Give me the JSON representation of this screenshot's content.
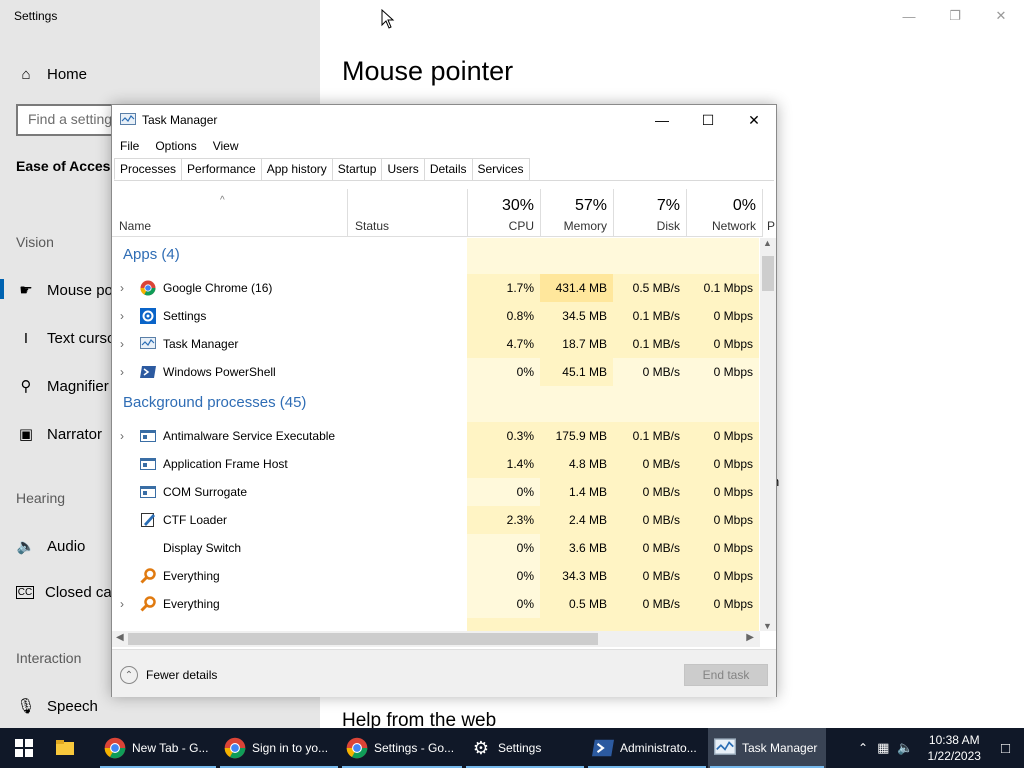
{
  "settings": {
    "window_title": "Settings",
    "nav_home": "Home",
    "search_placeholder": "Find a setting",
    "category": "Ease of Access",
    "section_vision": "Vision",
    "item_mouse": "Mouse pointer",
    "item_text_cursor": "Text cursor",
    "item_magnifier": "Magnifier",
    "item_narrator": "Narrator",
    "section_hearing": "Hearing",
    "item_audio": "Audio",
    "item_captions": "Closed captions",
    "section_interaction": "Interaction",
    "item_speech": "Speech",
    "page_title": "Mouse pointer",
    "help_title": "Help from the web",
    "stray_text": "n"
  },
  "taskmanager": {
    "title": "Task Manager",
    "menu": [
      "File",
      "Options",
      "View"
    ],
    "tabs": [
      "Processes",
      "Performance",
      "App history",
      "Startup",
      "Users",
      "Details",
      "Services"
    ],
    "columns": {
      "name": "Name",
      "status": "Status",
      "cpu_pct": "30%",
      "cpu": "CPU",
      "mem_pct": "57%",
      "mem": "Memory",
      "disk_pct": "7%",
      "disk": "Disk",
      "net_pct": "0%",
      "net": "Network",
      "power": "P"
    },
    "groups": {
      "apps": "Apps (4)",
      "background": "Background processes (45)"
    },
    "apps": [
      {
        "name": "Google Chrome (16)",
        "cpu": "1.7%",
        "mem": "431.4 MB",
        "disk": "0.5 MB/s",
        "net": "0.1 Mbps"
      },
      {
        "name": "Settings",
        "cpu": "0.8%",
        "mem": "34.5 MB",
        "disk": "0.1 MB/s",
        "net": "0 Mbps"
      },
      {
        "name": "Task Manager",
        "cpu": "4.7%",
        "mem": "18.7 MB",
        "disk": "0.1 MB/s",
        "net": "0 Mbps"
      },
      {
        "name": "Windows PowerShell",
        "cpu": "0%",
        "mem": "45.1 MB",
        "disk": "0 MB/s",
        "net": "0 Mbps"
      }
    ],
    "background": [
      {
        "name": "Antimalware Service Executable",
        "cpu": "0.3%",
        "mem": "175.9 MB",
        "disk": "0.1 MB/s",
        "net": "0 Mbps"
      },
      {
        "name": "Application Frame Host",
        "cpu": "1.4%",
        "mem": "4.8 MB",
        "disk": "0 MB/s",
        "net": "0 Mbps"
      },
      {
        "name": "COM Surrogate",
        "cpu": "0%",
        "mem": "1.4 MB",
        "disk": "0 MB/s",
        "net": "0 Mbps"
      },
      {
        "name": "CTF Loader",
        "cpu": "2.3%",
        "mem": "2.4 MB",
        "disk": "0 MB/s",
        "net": "0 Mbps"
      },
      {
        "name": "Display Switch",
        "cpu": "0%",
        "mem": "3.6 MB",
        "disk": "0 MB/s",
        "net": "0 Mbps"
      },
      {
        "name": "Everything",
        "cpu": "0%",
        "mem": "34.3 MB",
        "disk": "0 MB/s",
        "net": "0 Mbps"
      },
      {
        "name": "Everything",
        "cpu": "0%",
        "mem": "0.5 MB",
        "disk": "0 MB/s",
        "net": "0 Mbps"
      }
    ],
    "fewer_details": "Fewer details",
    "end_task": "End task"
  },
  "taskbar": {
    "items": [
      "New Tab - G...",
      "Sign in to yo...",
      "Settings - Go...",
      "Settings",
      "Administrato...",
      "Task Manager"
    ],
    "time": "10:38 AM",
    "date": "1/22/2023"
  },
  "colors": {
    "accent": "#0063b1",
    "group_blue": "#2f6db5",
    "taskbar": "#101828"
  }
}
